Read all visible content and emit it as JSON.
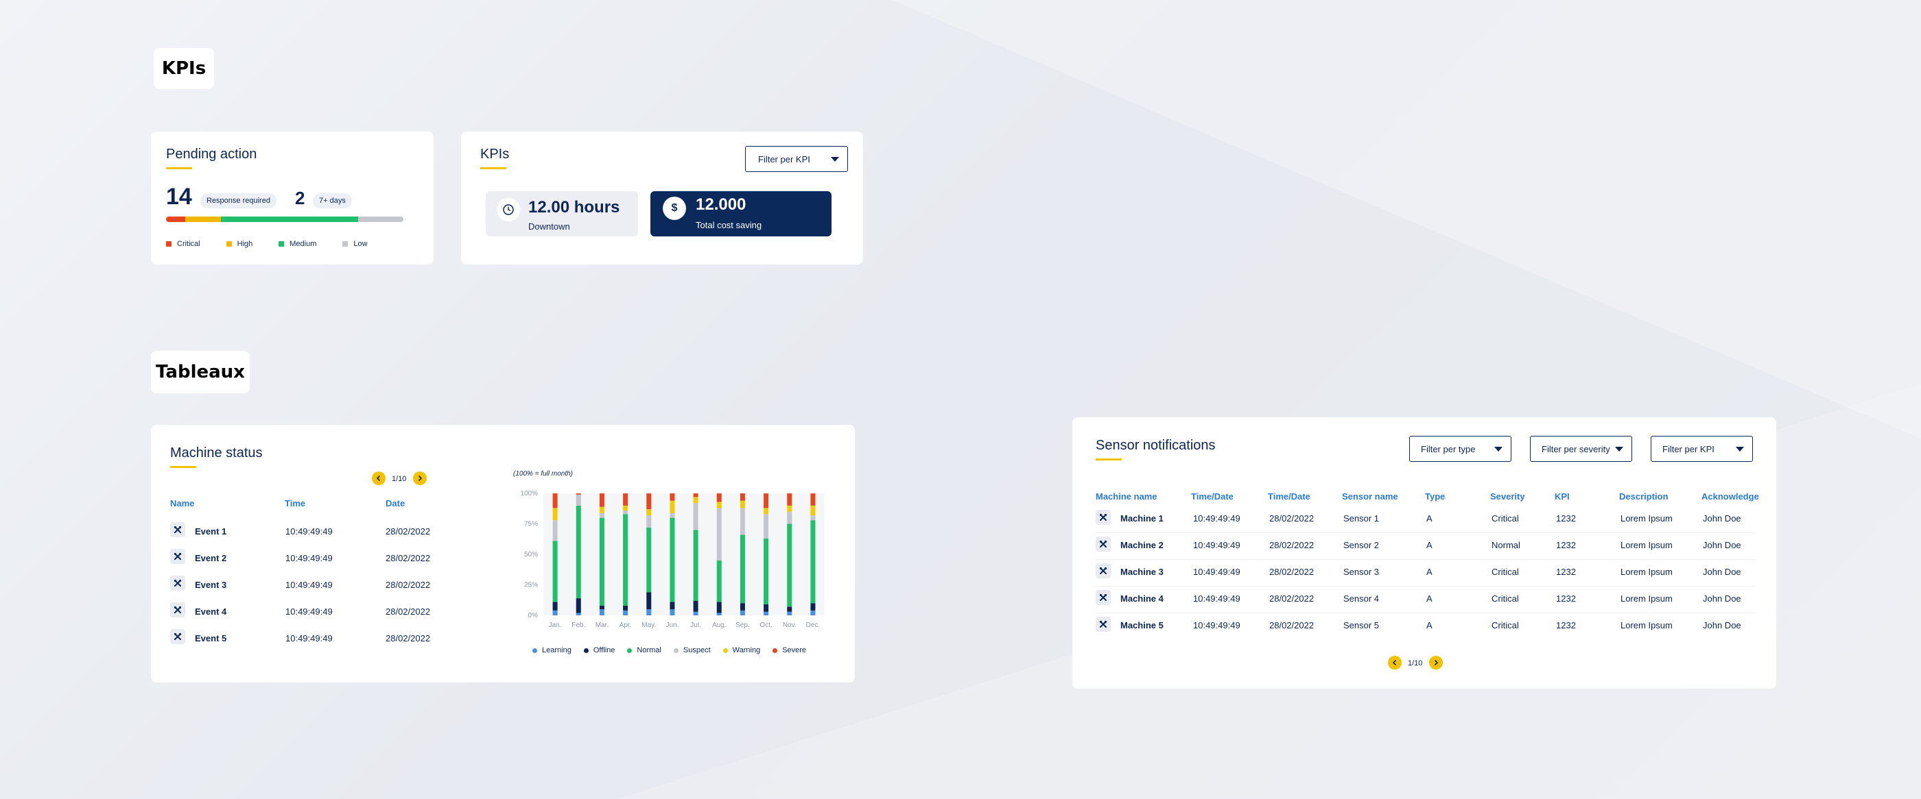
{
  "sections": {
    "kpis_title": "KPIs",
    "tableaux_title": "Tableaux"
  },
  "pending": {
    "title": "Pending action",
    "count1": "14",
    "pill1": "Response required",
    "count2": "2",
    "pill2": "7+ days",
    "bar": [
      {
        "name": "Critical",
        "fraction": 0.08,
        "color": "#e8471e"
      },
      {
        "name": "High",
        "fraction": 0.15,
        "color": "#f2b705"
      },
      {
        "name": "Medium",
        "fraction": 0.58,
        "color": "#1fbf6c"
      },
      {
        "name": "Low",
        "fraction": 0.19,
        "color": "#c3c6cc"
      }
    ],
    "legend": [
      {
        "label": "Critical",
        "color": "#e8471e"
      },
      {
        "label": "High",
        "color": "#f2b705"
      },
      {
        "label": "Medium",
        "color": "#1fbf6c"
      },
      {
        "label": "Low",
        "color": "#c3c6cc"
      }
    ]
  },
  "kpis": {
    "title": "KPIs",
    "filter": "Filter per KPI",
    "box1": {
      "value": "12.00 hours",
      "label": "Downtown",
      "icon": "clock-icon"
    },
    "box2": {
      "value": "12.000",
      "label": "Total cost saving",
      "icon": "dollar-icon"
    },
    "colors": {
      "navy": "#0b2a5b",
      "box1_bg": "#eceef3"
    }
  },
  "machine_status": {
    "title": "Machine status",
    "pager": "1/10",
    "columns": [
      "Name",
      "Time",
      "Date"
    ],
    "rows": [
      {
        "name": "Event 1",
        "time": "10:49:49:49",
        "date": "28/02/2022"
      },
      {
        "name": "Event 2",
        "time": "10:49:49:49",
        "date": "28/02/2022"
      },
      {
        "name": "Event 3",
        "time": "10:49:49:49",
        "date": "28/02/2022"
      },
      {
        "name": "Event 4",
        "time": "10:49:49:49",
        "date": "28/02/2022"
      },
      {
        "name": "Event 5",
        "time": "10:49:49:49",
        "date": "28/02/2022"
      }
    ]
  },
  "chart_data": {
    "type": "bar",
    "stacked": true,
    "note": "(100% = full month)",
    "categories": [
      "Jan.",
      "Feb.",
      "Mar.",
      "Apr.",
      "May.",
      "Jun.",
      "Jul.",
      "Aug.",
      "Sep.",
      "Oct.",
      "Nov.",
      "Dec."
    ],
    "yticks": [
      "0%",
      "25%",
      "50%",
      "75%",
      "100%"
    ],
    "ylim": [
      0,
      100
    ],
    "series": [
      {
        "name": "Learning",
        "color": "#4a90e2",
        "values": [
          4,
          2,
          5,
          4,
          5,
          5,
          3,
          2,
          4,
          3,
          3,
          4
        ]
      },
      {
        "name": "Offline",
        "color": "#0d2553",
        "values": [
          7,
          12,
          3,
          4,
          14,
          6,
          9,
          9,
          6,
          6,
          4,
          6
        ]
      },
      {
        "name": "Normal",
        "color": "#1fbf6c",
        "values": [
          50,
          76,
          72,
          75,
          53,
          69,
          58,
          34,
          56,
          54,
          68,
          68
        ]
      },
      {
        "name": "Suspect",
        "color": "#c3c6cc",
        "values": [
          17,
          9,
          4,
          3,
          10,
          4,
          22,
          43,
          22,
          20,
          10,
          4
        ]
      },
      {
        "name": "Warning",
        "color": "#f2cb05",
        "values": [
          10,
          0,
          5,
          4,
          5,
          10,
          5,
          5,
          6,
          5,
          5,
          8
        ]
      },
      {
        "name": "Severe",
        "color": "#e8471e",
        "values": [
          12,
          1,
          11,
          10,
          13,
          6,
          3,
          7,
          6,
          12,
          10,
          10
        ]
      }
    ]
  },
  "sensor": {
    "title": "Sensor notifications",
    "filters": [
      "Filter per type",
      "Filter per severity",
      "Filter per KPI"
    ],
    "columns": [
      "Machine name",
      "Time/Date",
      "Time/Date",
      "Sensor name",
      "Type",
      "Severity",
      "KPI",
      "Description",
      "Acknowledge"
    ],
    "rows": [
      [
        "Machine 1",
        "10:49:49:49",
        "28/02/2022",
        "Sensor 1",
        "A",
        "Critical",
        "1232",
        "Lorem Ipsum",
        "John Doe"
      ],
      [
        "Machine 2",
        "10:49:49:49",
        "28/02/2022",
        "Sensor 2",
        "A",
        "Normal",
        "1232",
        "Lorem Ipsum",
        "John Doe"
      ],
      [
        "Machine 3",
        "10:49:49:49",
        "28/02/2022",
        "Sensor 3",
        "A",
        "Critical",
        "1232",
        "Lorem Ipsum",
        "John Doe"
      ],
      [
        "Machine 4",
        "10:49:49:49",
        "28/02/2022",
        "Sensor 4",
        "A",
        "Critical",
        "1232",
        "Lorem Ipsum",
        "John Doe"
      ],
      [
        "Machine 5",
        "10:49:49:49",
        "28/02/2022",
        "Sensor 5",
        "A",
        "Critical",
        "1232",
        "Lorem Ipsum",
        "John Doe"
      ]
    ],
    "pager": "1/10"
  }
}
